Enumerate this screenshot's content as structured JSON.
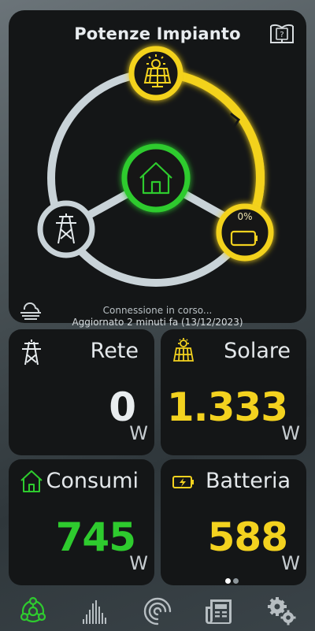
{
  "panel": {
    "title": "Potenze Impianto",
    "status": "Connessione in corso...",
    "updated": "Aggiornato 2 minuti fa (13/12/2023)",
    "battery_percent": "0%"
  },
  "cards": {
    "rete": {
      "label": "Rete",
      "value": "0",
      "unit": "W"
    },
    "solare": {
      "label": "Solare",
      "value": "1.333",
      "unit": "W"
    },
    "consumi": {
      "label": "Consumi",
      "value": "745",
      "unit": "W"
    },
    "batteria": {
      "label": "Batteria",
      "value": "588",
      "unit": "W"
    }
  },
  "colors": {
    "yellow": "#f3d21f",
    "green": "#2ecb2e",
    "grey_link": "#c9d3d8",
    "white_value": "#e9edef",
    "nav_active": "#2ecb2e",
    "nav_inactive": "#b7bec2"
  },
  "icons": {
    "manual": "manual-book-icon",
    "weather": "fog-weather-icon",
    "grid": "power-tower-icon",
    "solar": "solar-panel-icon",
    "home": "house-icon",
    "battery": "battery-icon"
  },
  "nav": {
    "items": [
      "nav-energy-flow",
      "nav-history-chart",
      "nav-gauge",
      "nav-news",
      "nav-settings"
    ],
    "active_index": 0
  },
  "pager": {
    "pages": 2,
    "current": 1
  }
}
